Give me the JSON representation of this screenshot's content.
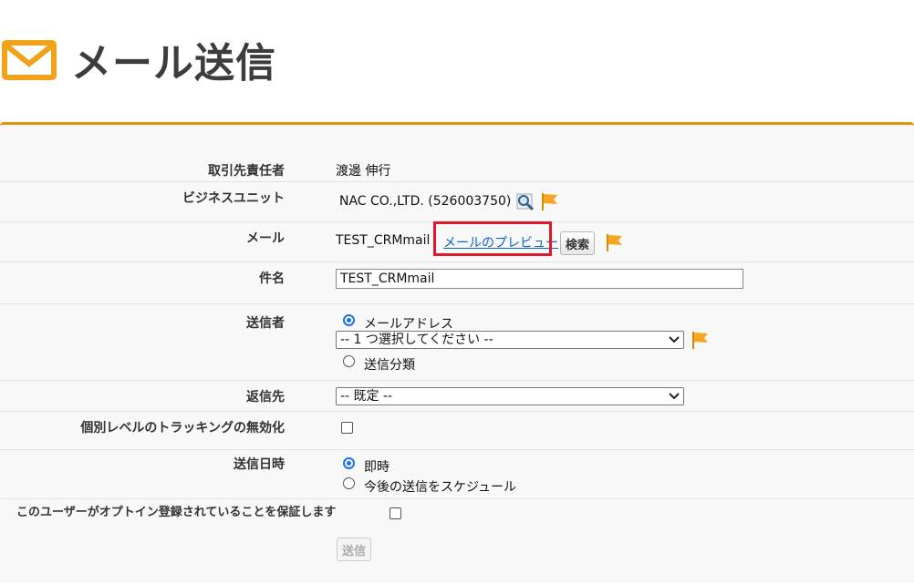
{
  "page": {
    "title": "メール送信"
  },
  "form": {
    "contact": {
      "label": "取引先責任者",
      "value": "渡邊 伸行"
    },
    "business_unit": {
      "label": "ビジネスユニット",
      "value": "NAC CO.,LTD. (526003750)"
    },
    "mail": {
      "label": "メール",
      "value": "TEST_CRMmail",
      "preview_link": "メールのプレビュー",
      "search_button": "検索"
    },
    "subject": {
      "label": "件名",
      "value": "TEST_CRMmail"
    },
    "sender": {
      "label": "送信者",
      "option_address": "メールアドレス",
      "select_value": "-- 1 つ選択してください --",
      "option_category": "送信分類",
      "selected": "メールアドレス"
    },
    "reply_to": {
      "label": "返信先",
      "select_value": "-- 既定 --"
    },
    "tracking": {
      "label": "個別レベルのトラッキングの無効化",
      "checked": false
    },
    "send_time": {
      "label": "送信日時",
      "option_now": "即時",
      "option_schedule": "今後の送信をスケジュール",
      "selected": "即時"
    },
    "opt_in": {
      "label": "このユーザーがオプトイン登録されていることを保証します",
      "checked": false
    },
    "submit_button": "送信"
  },
  "colors": {
    "accent": "#e2900e",
    "highlight_box": "#e0182d",
    "link": "#0a64c8",
    "radio": "#1a73e8"
  }
}
